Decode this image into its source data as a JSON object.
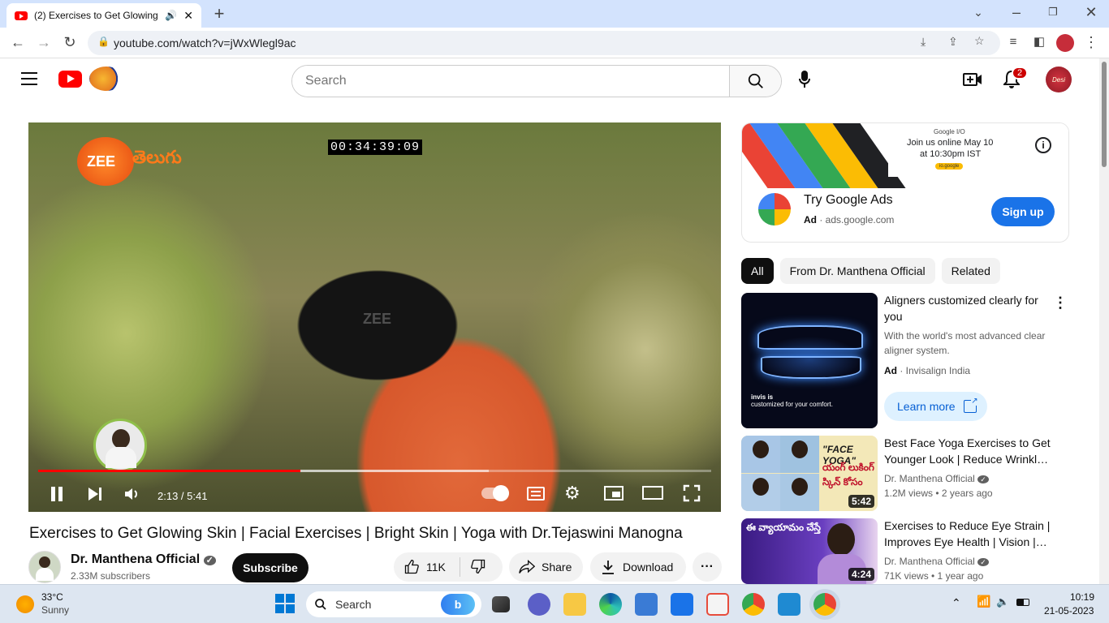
{
  "browser": {
    "tab_title": "(2) Exercises to Get Glowing",
    "url": "youtube.com/watch?v=jWxWlegl9ac"
  },
  "youtube": {
    "search_placeholder": "Search",
    "notifications_count": "2",
    "profile_label": "Desi"
  },
  "player": {
    "timecode_overlay": "00:34:39:09",
    "logo_text": "ZEE",
    "logo_script": "తెలుగు",
    "watermark": "ZEE",
    "time": "2:13 / 5:41",
    "progress_fraction": 0.39
  },
  "video": {
    "title": "Exercises to Get Glowing Skin | Facial Exercises | Bright Skin | Yoga with Dr.Tejaswini Manogna",
    "channel": "Dr. Manthena Official",
    "subscribers": "2.33M subscribers",
    "subscribe_label": "Subscribe",
    "likes": "11K",
    "share_label": "Share",
    "download_label": "Download"
  },
  "ad": {
    "banner_brand": "Google I/O",
    "banner_line1": "Join us online May 10",
    "banner_line2": "at 10:30pm IST",
    "banner_cta": "io.google",
    "title": "Try Google Ads",
    "ad_label": "Ad",
    "domain": "· ads.google.com",
    "cta": "Sign up"
  },
  "chips": [
    "All",
    "From Dr. Manthena Official",
    "Related"
  ],
  "sponsored": {
    "title": "Aligners customized clearly for you",
    "description": "With the world's most advanced clear aligner system.",
    "ad_label": "Ad",
    "advertiser": "· Invisalign India",
    "cta": "Learn more",
    "thumb_line1": "invis is",
    "thumb_line2": "customized for your comfort."
  },
  "recommendations": [
    {
      "title": "Best Face Yoga Exercises to Get Younger Look | Reduce Wrinkl…",
      "channel": "Dr. Manthena Official",
      "stats": "1.2M views • 2 years ago",
      "duration": "5:42",
      "thumb_text": "\"FACE YOGA\"",
      "thumb_text2": "యంగ్ లుకింగ్ స్కిన్ కోసం"
    },
    {
      "title": "Exercises to Reduce Eye Strain | Improves Eye Health | Vision |…",
      "channel": "Dr. Manthena Official",
      "stats": "71K views • 1 year ago",
      "duration": "4:24",
      "thumb_text": "ఈ వ్యాయామం చేస్తే"
    }
  ],
  "taskbar": {
    "temperature": "33°C",
    "weather": "Sunny",
    "search_label": "Search",
    "time": "10:19",
    "date": "21-05-2023"
  },
  "colors": {
    "youtube_red": "#ff0000",
    "accent_blue": "#065fd4",
    "signup_blue": "#1a73e8"
  }
}
